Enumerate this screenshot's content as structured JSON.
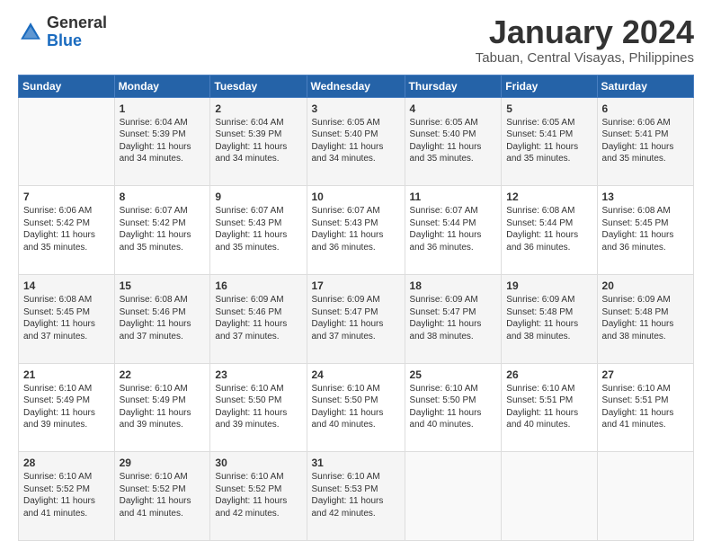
{
  "header": {
    "logo_general": "General",
    "logo_blue": "Blue",
    "month_title": "January 2024",
    "location": "Tabuan, Central Visayas, Philippines"
  },
  "days_of_week": [
    "Sunday",
    "Monday",
    "Tuesday",
    "Wednesday",
    "Thursday",
    "Friday",
    "Saturday"
  ],
  "weeks": [
    [
      {
        "day": "",
        "info": ""
      },
      {
        "day": "1",
        "info": "Sunrise: 6:04 AM\nSunset: 5:39 PM\nDaylight: 11 hours\nand 34 minutes."
      },
      {
        "day": "2",
        "info": "Sunrise: 6:04 AM\nSunset: 5:39 PM\nDaylight: 11 hours\nand 34 minutes."
      },
      {
        "day": "3",
        "info": "Sunrise: 6:05 AM\nSunset: 5:40 PM\nDaylight: 11 hours\nand 34 minutes."
      },
      {
        "day": "4",
        "info": "Sunrise: 6:05 AM\nSunset: 5:40 PM\nDaylight: 11 hours\nand 35 minutes."
      },
      {
        "day": "5",
        "info": "Sunrise: 6:05 AM\nSunset: 5:41 PM\nDaylight: 11 hours\nand 35 minutes."
      },
      {
        "day": "6",
        "info": "Sunrise: 6:06 AM\nSunset: 5:41 PM\nDaylight: 11 hours\nand 35 minutes."
      }
    ],
    [
      {
        "day": "7",
        "info": "Sunrise: 6:06 AM\nSunset: 5:42 PM\nDaylight: 11 hours\nand 35 minutes."
      },
      {
        "day": "8",
        "info": "Sunrise: 6:07 AM\nSunset: 5:42 PM\nDaylight: 11 hours\nand 35 minutes."
      },
      {
        "day": "9",
        "info": "Sunrise: 6:07 AM\nSunset: 5:43 PM\nDaylight: 11 hours\nand 35 minutes."
      },
      {
        "day": "10",
        "info": "Sunrise: 6:07 AM\nSunset: 5:43 PM\nDaylight: 11 hours\nand 36 minutes."
      },
      {
        "day": "11",
        "info": "Sunrise: 6:07 AM\nSunset: 5:44 PM\nDaylight: 11 hours\nand 36 minutes."
      },
      {
        "day": "12",
        "info": "Sunrise: 6:08 AM\nSunset: 5:44 PM\nDaylight: 11 hours\nand 36 minutes."
      },
      {
        "day": "13",
        "info": "Sunrise: 6:08 AM\nSunset: 5:45 PM\nDaylight: 11 hours\nand 36 minutes."
      }
    ],
    [
      {
        "day": "14",
        "info": "Sunrise: 6:08 AM\nSunset: 5:45 PM\nDaylight: 11 hours\nand 37 minutes."
      },
      {
        "day": "15",
        "info": "Sunrise: 6:08 AM\nSunset: 5:46 PM\nDaylight: 11 hours\nand 37 minutes."
      },
      {
        "day": "16",
        "info": "Sunrise: 6:09 AM\nSunset: 5:46 PM\nDaylight: 11 hours\nand 37 minutes."
      },
      {
        "day": "17",
        "info": "Sunrise: 6:09 AM\nSunset: 5:47 PM\nDaylight: 11 hours\nand 37 minutes."
      },
      {
        "day": "18",
        "info": "Sunrise: 6:09 AM\nSunset: 5:47 PM\nDaylight: 11 hours\nand 38 minutes."
      },
      {
        "day": "19",
        "info": "Sunrise: 6:09 AM\nSunset: 5:48 PM\nDaylight: 11 hours\nand 38 minutes."
      },
      {
        "day": "20",
        "info": "Sunrise: 6:09 AM\nSunset: 5:48 PM\nDaylight: 11 hours\nand 38 minutes."
      }
    ],
    [
      {
        "day": "21",
        "info": "Sunrise: 6:10 AM\nSunset: 5:49 PM\nDaylight: 11 hours\nand 39 minutes."
      },
      {
        "day": "22",
        "info": "Sunrise: 6:10 AM\nSunset: 5:49 PM\nDaylight: 11 hours\nand 39 minutes."
      },
      {
        "day": "23",
        "info": "Sunrise: 6:10 AM\nSunset: 5:50 PM\nDaylight: 11 hours\nand 39 minutes."
      },
      {
        "day": "24",
        "info": "Sunrise: 6:10 AM\nSunset: 5:50 PM\nDaylight: 11 hours\nand 40 minutes."
      },
      {
        "day": "25",
        "info": "Sunrise: 6:10 AM\nSunset: 5:50 PM\nDaylight: 11 hours\nand 40 minutes."
      },
      {
        "day": "26",
        "info": "Sunrise: 6:10 AM\nSunset: 5:51 PM\nDaylight: 11 hours\nand 40 minutes."
      },
      {
        "day": "27",
        "info": "Sunrise: 6:10 AM\nSunset: 5:51 PM\nDaylight: 11 hours\nand 41 minutes."
      }
    ],
    [
      {
        "day": "28",
        "info": "Sunrise: 6:10 AM\nSunset: 5:52 PM\nDaylight: 11 hours\nand 41 minutes."
      },
      {
        "day": "29",
        "info": "Sunrise: 6:10 AM\nSunset: 5:52 PM\nDaylight: 11 hours\nand 41 minutes."
      },
      {
        "day": "30",
        "info": "Sunrise: 6:10 AM\nSunset: 5:52 PM\nDaylight: 11 hours\nand 42 minutes."
      },
      {
        "day": "31",
        "info": "Sunrise: 6:10 AM\nSunset: 5:53 PM\nDaylight: 11 hours\nand 42 minutes."
      },
      {
        "day": "",
        "info": ""
      },
      {
        "day": "",
        "info": ""
      },
      {
        "day": "",
        "info": ""
      }
    ]
  ]
}
